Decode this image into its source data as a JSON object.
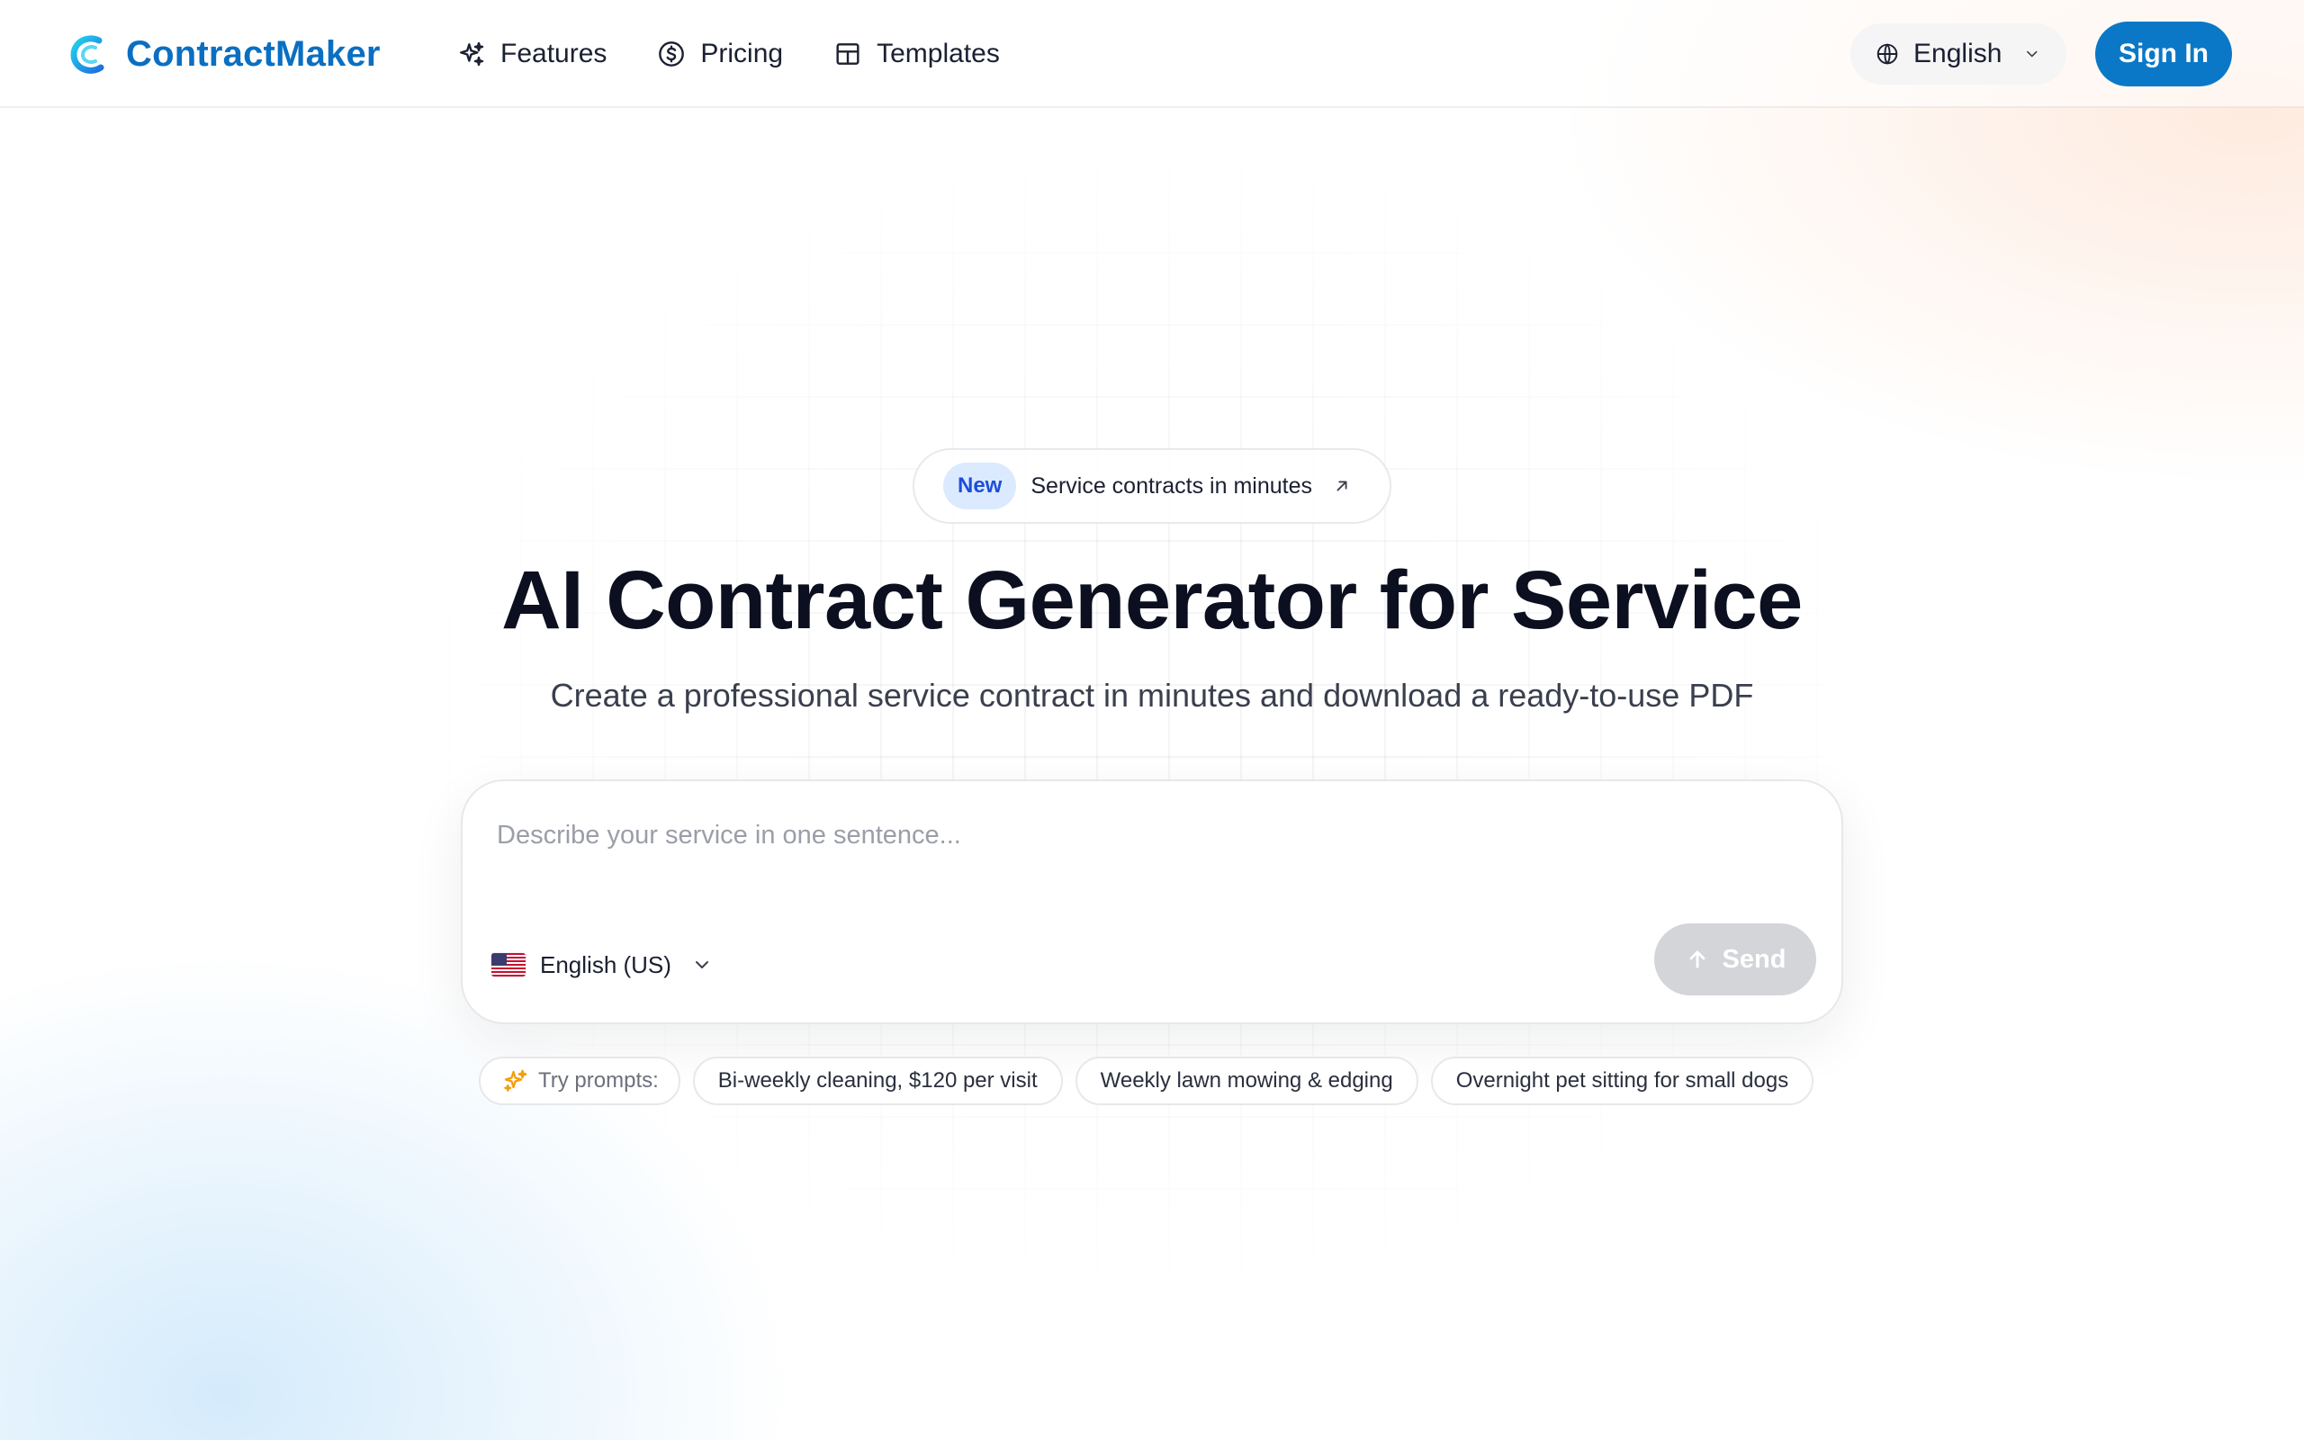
{
  "header": {
    "brand": "ContractMaker",
    "nav": [
      {
        "label": "Features",
        "icon": "sparkles-icon"
      },
      {
        "label": "Pricing",
        "icon": "dollar-circle-icon"
      },
      {
        "label": "Templates",
        "icon": "grid-icon"
      }
    ],
    "language": {
      "label": "English",
      "icon": "globe-icon"
    },
    "sign_in_label": "Sign In"
  },
  "hero": {
    "badge": {
      "tag": "New",
      "text": "Service contracts in minutes"
    },
    "title": "AI Contract Generator for Service",
    "subtitle": "Create a professional service contract in minutes and download a ready-to-use PDF"
  },
  "composer": {
    "placeholder": "Describe your service in one sentence...",
    "value": "",
    "locale": {
      "label": "English (US)",
      "flag": "us-flag-icon"
    },
    "send_label": "Send"
  },
  "prompts": {
    "label": "Try prompts:",
    "items": [
      "Bi-weekly cleaning, $120 per visit",
      "Weekly lawn mowing & edging",
      "Overnight pet sitting for small dogs"
    ]
  },
  "colors": {
    "brand": "#0a6fc2",
    "primary_button": "#0a78c6",
    "send_disabled": "#d4d5d8",
    "badge_bg": "#dbeafe",
    "badge_text": "#1d4ed8",
    "sparkle_accent": "#f59e0b"
  }
}
